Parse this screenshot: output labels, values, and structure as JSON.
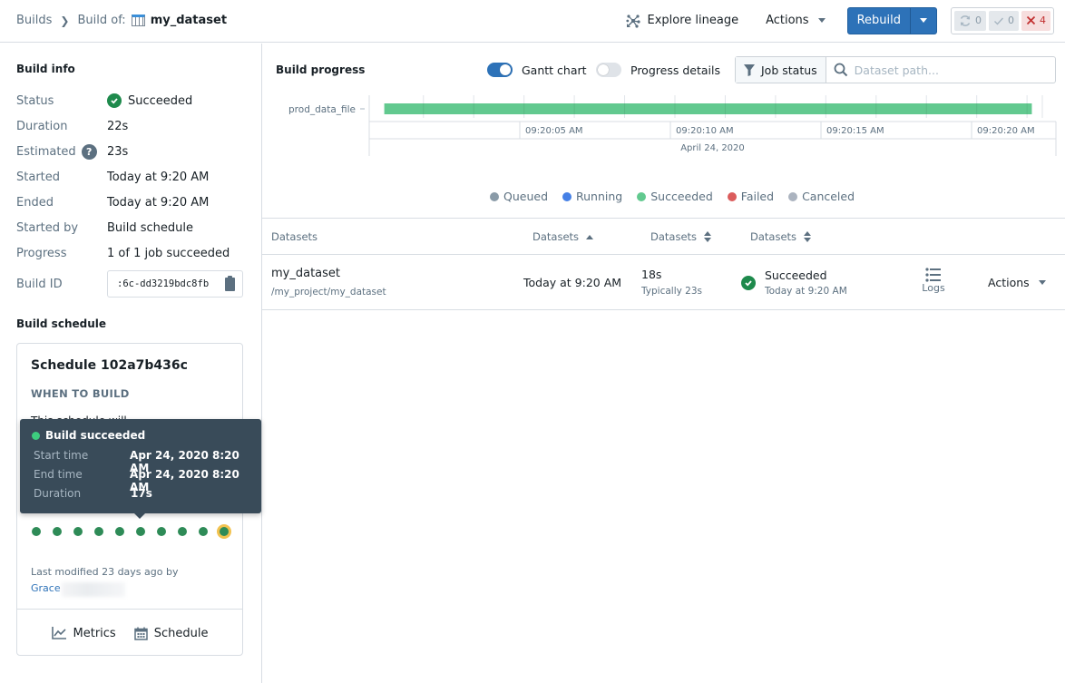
{
  "header": {
    "breadcrumb": {
      "root": "Builds",
      "build_of_label": "Build of:",
      "dataset_icon": "table-icon",
      "current": "my_dataset"
    },
    "explore_lineage": "Explore lineage",
    "actions": "Actions",
    "rebuild": "Rebuild",
    "counters": {
      "running": "0",
      "succeeded": "0",
      "failed": "4"
    }
  },
  "build_info": {
    "title": "Build info",
    "rows": {
      "status": {
        "label": "Status",
        "value": "Succeeded"
      },
      "duration": {
        "label": "Duration",
        "value": "22s"
      },
      "estimated": {
        "label": "Estimated",
        "value": "23s"
      },
      "started": {
        "label": "Started",
        "value": "Today at 9:20 AM"
      },
      "ended": {
        "label": "Ended",
        "value": "Today at 9:20 AM"
      },
      "started_by": {
        "label": "Started by",
        "value": "Build schedule"
      },
      "progress": {
        "label": "Progress",
        "value": "1 of 1 job succeeded"
      },
      "build_id": {
        "label": "Build ID",
        "value": ":6c-dd3219bdc8fb"
      }
    }
  },
  "build_schedule": {
    "title": "Build schedule",
    "card": {
      "name": "Schedule 102a7b436c",
      "subtitle": "WHEN TO BUILD",
      "partial_text": "This schedule will",
      "run_count": 10,
      "run_status": [
        "succeeded",
        "succeeded",
        "succeeded",
        "succeeded",
        "succeeded",
        "succeeded",
        "succeeded",
        "succeeded",
        "succeeded",
        "succeeded"
      ],
      "last_modified": "Last modified 23 days ago by",
      "author": "Grace",
      "metrics": "Metrics",
      "schedule": "Schedule"
    },
    "tooltip": {
      "title": "Build succeeded",
      "start_label": "Start time",
      "start_value": "Apr 24, 2020 8:20 AM",
      "end_label": "End time",
      "end_value": "Apr 24, 2020 8:20 AM",
      "duration_label": "Duration",
      "duration_value": "17s"
    }
  },
  "build_progress": {
    "title": "Build progress",
    "gantt_toggle": {
      "label": "Gantt chart",
      "on": true
    },
    "progress_toggle": {
      "label": "Progress details",
      "on": false
    },
    "job_status": "Job status",
    "search_placeholder": "Dataset path...",
    "gantt": {
      "row_label": "prod_data_file",
      "start_seconds": 0.5,
      "end_seconds": 22.0,
      "axis_start_seconds": 0,
      "axis_end_seconds": 22.8,
      "ticks": [
        {
          "seconds": 1.8,
          "label": ""
        },
        {
          "seconds": 5,
          "label": "09:20:05 AM"
        },
        {
          "seconds": 10,
          "label": "09:20:10 AM"
        },
        {
          "seconds": 15,
          "label": "09:20:15 AM"
        },
        {
          "seconds": 20,
          "label": "09:20:20 AM"
        }
      ],
      "date_label": "April 24, 2020"
    },
    "legend": [
      {
        "label": "Queued",
        "color": "#8a9ba8"
      },
      {
        "label": "Running",
        "color": "#4580e6"
      },
      {
        "label": "Succeeded",
        "color": "#62c98f"
      },
      {
        "label": "Failed",
        "color": "#db5c5c"
      },
      {
        "label": "Canceled",
        "color": "#abb3bf"
      }
    ]
  },
  "table": {
    "headers": [
      "Datasets",
      "Datasets",
      "Datasets",
      "Datasets"
    ],
    "rows": [
      {
        "name": "my_dataset",
        "path": "/my_project/my_dataset",
        "started": "Today at 9:20 AM",
        "duration": "18s",
        "typical": "Typically 23s",
        "status": "Succeeded",
        "status_time": "Today at 9:20 AM",
        "logs": "Logs",
        "actions": "Actions"
      }
    ]
  },
  "colors": {
    "accent": "#2d72b8",
    "success": "#1e8a4c",
    "gantt_bar": "#62c98f",
    "tooltip_bg": "#394b59"
  }
}
